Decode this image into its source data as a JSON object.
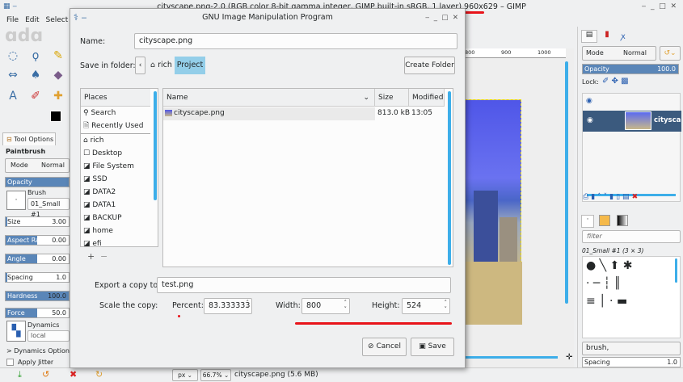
{
  "window": {
    "title": "cityscape.png-2.0 (RGB color 8-bit gamma integer, GIMP built-in sRGB, 1 layer) 960x629 – GIMP"
  },
  "menu": [
    "File",
    "Edit",
    "Select"
  ],
  "tool_options": {
    "tab": "Tool Options",
    "tool": "Paintbrush",
    "mode_label": "Mode",
    "mode_value": "Normal",
    "opacity_label": "Opacity",
    "brush_label": "Brush",
    "brush_value": "01_Small #1",
    "sliders": [
      {
        "label": "Size",
        "value": "3.00",
        "fill": 0.03
      },
      {
        "label": "Aspect Ratio",
        "value": "0.00",
        "fill": 0.5
      },
      {
        "label": "Angle",
        "value": "0.00",
        "fill": 0.5
      },
      {
        "label": "Spacing",
        "value": "1.0",
        "fill": 0.01
      },
      {
        "label": "Hardness",
        "value": "100.0",
        "fill": 1.0
      },
      {
        "label": "Force",
        "value": "50.0",
        "fill": 0.5
      }
    ],
    "dynamics_label": "Dynamics",
    "dynamics_value": "local",
    "dynamics_options": "> Dynamics Options",
    "apply_jitter": "Apply Jitter"
  },
  "dialog": {
    "title": "GNU Image Manipulation Program",
    "name_label": "Name:",
    "name_value": "cityscape.png",
    "folder_label": "Save in folder:",
    "crumb_home": "rich",
    "crumb_current": "Project",
    "create_folder": "Create Folder",
    "places_header": "Places",
    "places": [
      "Search",
      "Recently Used",
      "rich",
      "Desktop",
      "File System",
      "SSD",
      "DATA2",
      "DATA1",
      "BACKUP",
      "home",
      "efi"
    ],
    "columns": {
      "name": "Name",
      "size": "Size",
      "modified": "Modified"
    },
    "files": [
      {
        "name": "cityscape.png",
        "size": "813.0 kB",
        "modified": "13:05"
      }
    ],
    "export_label": "Export a copy to:",
    "export_value": "test.png",
    "scale_label": "Scale the copy:",
    "percent_label": "Percent:",
    "percent_value": "83.333333",
    "width_label": "Width:",
    "width_value": "800",
    "height_label": "Height:",
    "height_value": "524",
    "cancel": "Cancel",
    "save": "Save"
  },
  "ruler": [
    "800",
    "900",
    "1000"
  ],
  "layers": {
    "mode_label": "Mode",
    "mode_value": "Normal",
    "opacity_label": "Opacity",
    "opacity_value": "100.0",
    "lock_label": "Lock:",
    "layer_name": "cityscape.png"
  },
  "brushes": {
    "filter_placeholder": "filter",
    "current": "01_Small #1 (3 × 3)",
    "tag_value": "brush,",
    "spacing_label": "Spacing",
    "spacing_value": "1.0"
  },
  "status": {
    "unit": "px",
    "zoom": "66.7%",
    "info": "cityscape.png (5.6 MB)"
  },
  "colors": {
    "accent": "#3daee9",
    "slider": "#5a86b8",
    "selected_row": "#3b5a7e",
    "annotation": "#e8141a"
  }
}
